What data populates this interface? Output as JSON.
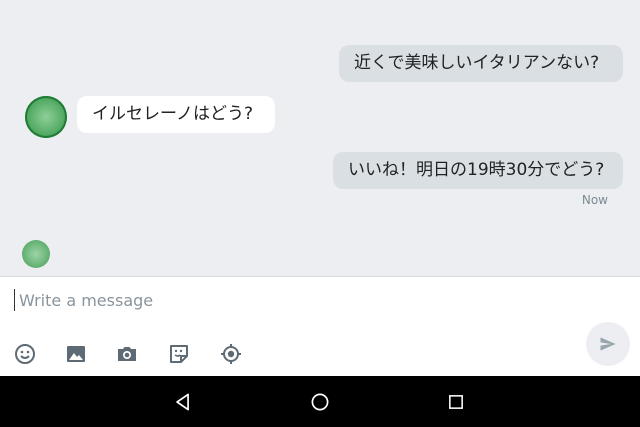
{
  "conversation": {
    "messages": [
      {
        "sender": "me",
        "text": "近くで美味しいイタリアンない?"
      },
      {
        "sender": "bot",
        "text": "イルセレーノはどう?"
      },
      {
        "sender": "me",
        "text": "いいね！明日の19時30分でどう?"
      }
    ],
    "last_status": "Now"
  },
  "composer": {
    "placeholder": "Write a message",
    "tools": [
      "emoji-icon",
      "image-icon",
      "camera-icon",
      "sticker-icon",
      "location-icon"
    ],
    "send_icon": "send-icon"
  },
  "navigation": [
    "back-icon",
    "home-icon",
    "recents-icon"
  ],
  "colors": {
    "chat_background": "#eceef1",
    "outgoing_bubble": "#d9dfe3",
    "incoming_bubble": "#ffffff",
    "avatar_green": "#57ad67",
    "icon_gray": "#5f6b74",
    "nav_background": "#000000"
  }
}
